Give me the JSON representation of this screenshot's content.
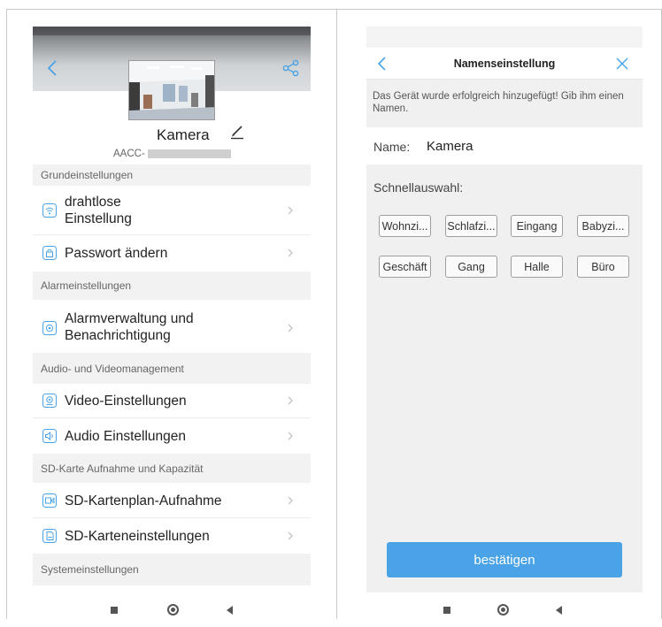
{
  "left_screen": {
    "camera": {
      "name": "Kamera",
      "id_prefix": "AACC-"
    },
    "icons": {
      "back": "chevron-left-icon",
      "share": "share-icon",
      "edit": "pencil-icon"
    },
    "sections": [
      {
        "header": "Grundeinstellungen",
        "items": [
          {
            "label_line1": "drahtlose",
            "label_line2": "Einstellung",
            "icon": "wifi-icon"
          },
          {
            "label_line1": "Passwort ändern",
            "label_line2": "",
            "icon": "lock-icon"
          }
        ]
      },
      {
        "header": "Alarmeinstellungen",
        "items": [
          {
            "label_line1": "Alarmverwaltung und",
            "label_line2": "Benachrichtigung",
            "icon": "alarm-icon"
          }
        ]
      },
      {
        "header": "Audio- und Videomanagement",
        "items": [
          {
            "label_line1": "Video-Einstellungen",
            "label_line2": "",
            "icon": "webcam-icon"
          },
          {
            "label_line1": "Audio Einstellungen",
            "label_line2": "",
            "icon": "speaker-icon"
          }
        ]
      },
      {
        "header": "SD-Karte Aufnahme und Kapazität",
        "items": [
          {
            "label_line1": "SD-Kartenplan-Aufnahme",
            "label_line2": "",
            "icon": "record-icon"
          },
          {
            "label_line1": "SD-Karteneinstellungen",
            "label_line2": "",
            "icon": "sdcard-icon"
          }
        ]
      },
      {
        "header": "Systemeinstellungen",
        "items": []
      }
    ]
  },
  "right_screen": {
    "title": "Namenseinstellung",
    "message": "Das Gerät wurde erfolgreich hinzugefügt! Gib ihm einen Namen.",
    "name_label": "Name:",
    "name_value": "Kamera",
    "quick_select_label": "Schnellauswahl:",
    "chips": [
      "Wohnzi...",
      "Schlafzi...",
      "Eingang",
      "Babyzi...",
      "Geschäft",
      "Gang",
      "Halle",
      "Büro"
    ],
    "confirm_label": "bestätigen"
  },
  "colors": {
    "accent": "#4aa3e6",
    "chevron": "#b8b8b8",
    "section_bg": "#f2f2f2"
  }
}
